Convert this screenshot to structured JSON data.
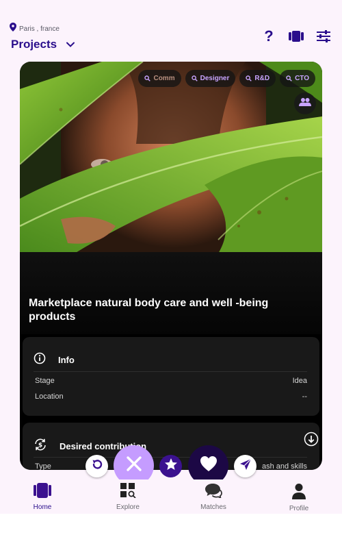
{
  "header": {
    "location": "Paris , france",
    "title": "Projects",
    "icons": [
      "help-icon",
      "cards-view-icon",
      "filter-icon"
    ],
    "help_glyph": "?"
  },
  "card": {
    "tags": [
      {
        "label": "Comm"
      },
      {
        "label": "Designer"
      },
      {
        "label": "R&D"
      },
      {
        "label": "CTO"
      }
    ],
    "title": "Marketplace natural body care and well -being products",
    "info": {
      "heading": "Info",
      "rows": [
        {
          "label": "Stage",
          "value": "Idea"
        },
        {
          "label": "Location",
          "value": "--"
        }
      ]
    },
    "contribution": {
      "heading": "Desired contribution",
      "rows": [
        {
          "label": "Type",
          "value": "ash and skills"
        }
      ]
    }
  },
  "actions": [
    "undo-icon",
    "reject-icon",
    "superlike-star-icon",
    "like-heart-icon",
    "send-icon"
  ],
  "nav": {
    "items": [
      {
        "label": "Home",
        "active": true
      },
      {
        "label": "Explore",
        "active": false
      },
      {
        "label": "Matches",
        "active": false
      },
      {
        "label": "Profile",
        "active": false
      }
    ]
  },
  "colors": {
    "primary": "#2a0e8c",
    "accent_light": "#c59cff",
    "card_bg": "#000000",
    "panel_bg": "#191919",
    "app_bg": "#fcf3fc"
  }
}
